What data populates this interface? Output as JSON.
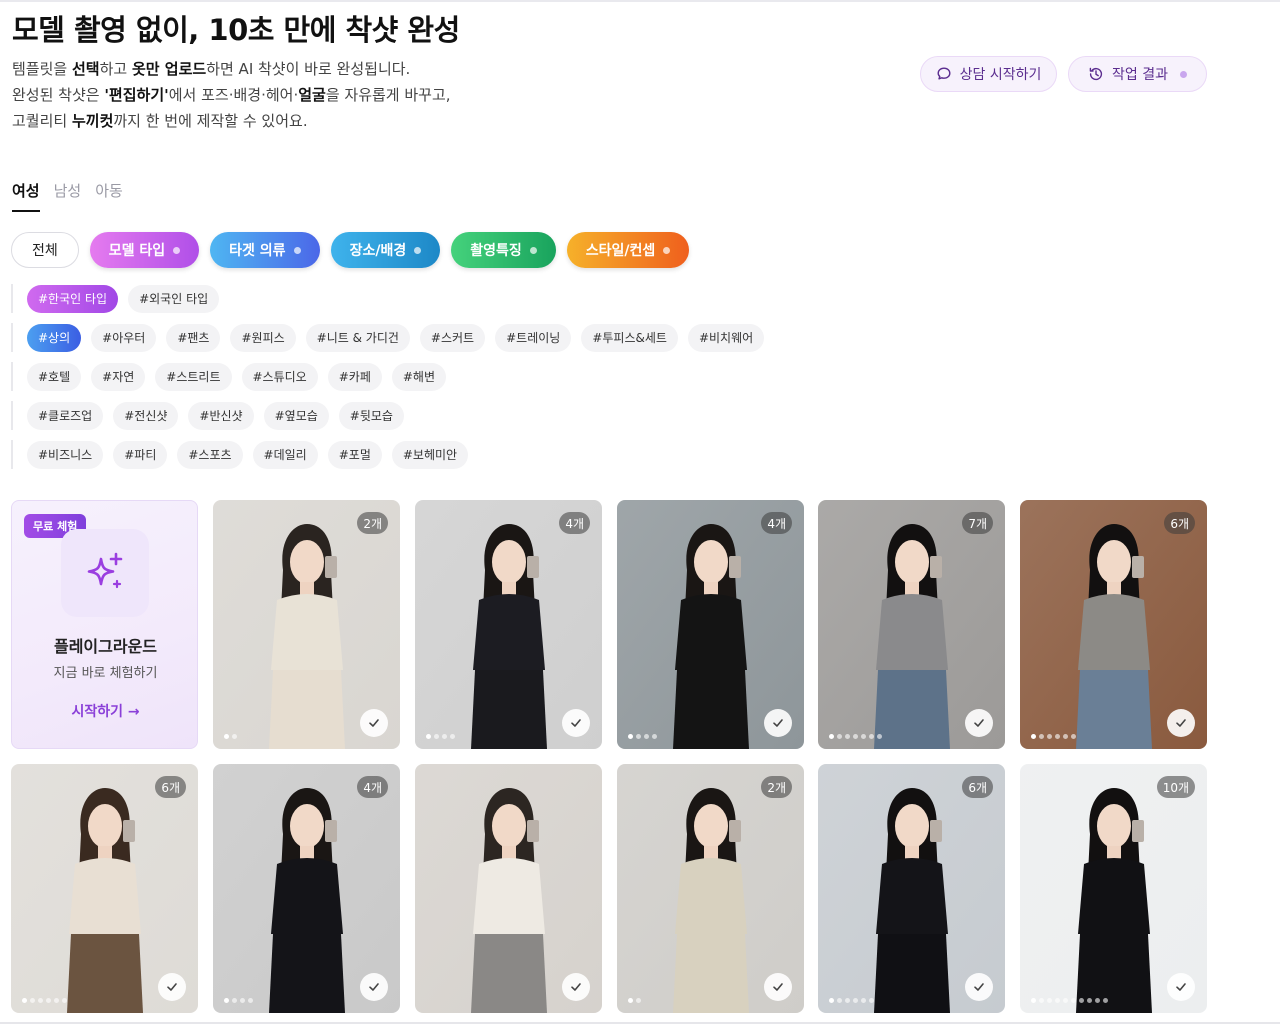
{
  "header": {
    "title": "모델 촬영 없이, 10초 만에 착샷 완성",
    "desc_line1": [
      "템플릿을 ",
      "선택",
      "하고 ",
      "옷만 업로드",
      "하면 AI 착샷이 바로 완성됩니다."
    ],
    "desc_line2": [
      "완성된 착샷은 ",
      "'편집하기'",
      "에서 포즈·배경·헤어·",
      "얼굴",
      "을 자유롭게 바꾸고,"
    ],
    "desc_line3": [
      "고퀄리티 ",
      "누끼컷",
      "까지 한 번에 제작할 수 있어요."
    ],
    "consult_label": "상담 시작하기",
    "result_label": "작업 결과"
  },
  "gender_tabs": [
    "여성",
    "남성",
    "아동"
  ],
  "categories": {
    "all": "전체",
    "model": "모델 타입",
    "target": "타겟 의류",
    "place": "장소/배경",
    "shoot": "촬영특징",
    "style": "스타일/컨셉"
  },
  "tag_rows": [
    [
      "#한국인 타입",
      "#외국인 타입"
    ],
    [
      "#상의",
      "#아우터",
      "#팬츠",
      "#원피스",
      "#니트 & 가디건",
      "#스커트",
      "#트레이닝",
      "#투피스&세트",
      "#비치웨어"
    ],
    [
      "#호텔",
      "#자연",
      "#스트리트",
      "#스튜디오",
      "#카페",
      "#해변"
    ],
    [
      "#클로즈업",
      "#전신샷",
      "#반신샷",
      "#옆모습",
      "#뒷모습"
    ],
    [
      "#비즈니스",
      "#파티",
      "#스포츠",
      "#데일리",
      "#포멀",
      "#보헤미안"
    ]
  ],
  "promo": {
    "badge": "무료 체험",
    "title": "플레이그라운드",
    "subtitle": "지금 바로 체험하기",
    "cta": "시작하기 →",
    "icon": "sparkle-icon"
  },
  "templates": [
    {
      "count": "2개",
      "dots": 2,
      "bg": "#d9d6d1",
      "top": "#e8e2d6",
      "bottom": "#e6ddd0",
      "hair": "#2a2420"
    },
    {
      "count": "4개",
      "dots": 4,
      "bg": "#cfcfcf",
      "top": "#1c1c22",
      "bottom": "#1a1a1e",
      "hair": "#1a1614"
    },
    {
      "count": "4개",
      "dots": 4,
      "bg": "#8e969a",
      "top": "#141414",
      "bottom": "#141414",
      "hair": "#1a1614"
    },
    {
      "count": "7개",
      "dots": 7,
      "bg": "#9c9a98",
      "top": "#8a8a8c",
      "bottom": "#5d7289",
      "hair": "#121010"
    },
    {
      "count": "6개",
      "dots": 6,
      "bg": "#8a5a3e",
      "top": "#8c8a86",
      "bottom": "#6a7f96",
      "hair": "#121010"
    },
    {
      "count": "6개",
      "dots": 6,
      "bg": "#dedbd6",
      "top": "#e8dfd3",
      "bottom": "#6b5440",
      "hair": "#3a2a20"
    },
    {
      "count": "4개",
      "dots": 4,
      "bg": "#c9c9c9",
      "top": "#141418",
      "bottom": "#141418",
      "hair": "#1a1614"
    },
    {
      "count": "",
      "dots": 0,
      "bg": "#d6d2cd",
      "top": "#eeeae3",
      "bottom": "#8a8886",
      "hair": "#2c2622"
    },
    {
      "count": "2개",
      "dots": 2,
      "bg": "#cfcdc9",
      "top": "#d8d1bf",
      "bottom": "#d8d1bf",
      "hair": "#1a1614"
    },
    {
      "count": "6개",
      "dots": 6,
      "bg": "#c6cbd0",
      "top": "#141418",
      "bottom": "#101014",
      "hair": "#121010"
    },
    {
      "count": "10개",
      "dots": 10,
      "bg": "#eceeef",
      "top": "#111114",
      "bottom": "#111114",
      "hair": "#121010"
    }
  ],
  "colors": {
    "accent": "#8a3fd8",
    "button_bg": "#f7f2fc"
  }
}
